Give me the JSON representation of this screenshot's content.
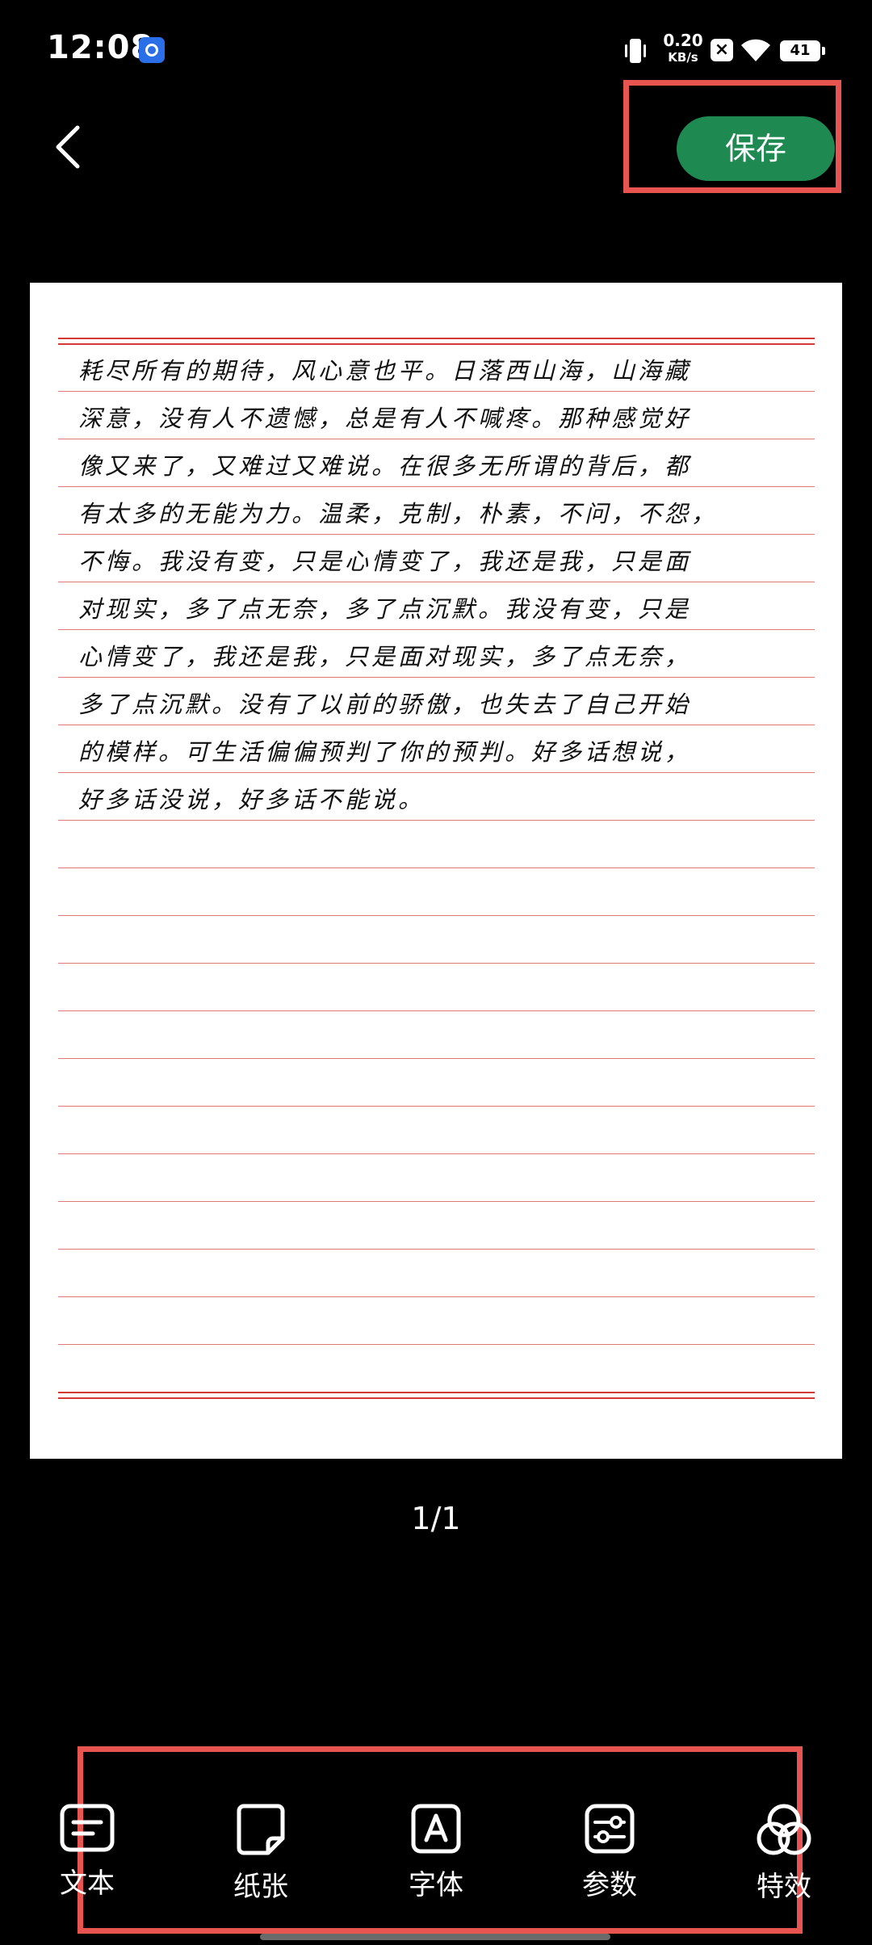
{
  "status_bar": {
    "time": "12:08",
    "net_speed_value": "0.20",
    "net_speed_unit": "KB/s",
    "battery": "41"
  },
  "header": {
    "save_label": "保存"
  },
  "paper": {
    "lines": [
      "耗尽所有的期待，风心意也平。日落西山海，山海藏",
      "深意，没有人不遗憾，总是有人不喊疼。那种感觉好",
      "像又来了，又难过又难说。在很多无所谓的背后，都",
      "有太多的无能为力。温柔，克制，朴素，不问，不怨，",
      "不悔。我没有变，只是心情变了，我还是我，只是面",
      "对现实，多了点无奈，多了点沉默。我没有变，只是",
      "心情变了，我还是我，只是面对现实，多了点无奈，",
      "多了点沉默。没有了以前的骄傲，也失去了自己开始",
      "的模样。可生活偏偏预判了你的预判。好多话想说，",
      "好多话没说，好多话不能说。"
    ]
  },
  "page_indicator": "1/1",
  "toolbar": {
    "items": [
      {
        "label": "文本",
        "icon": "text-icon"
      },
      {
        "label": "纸张",
        "icon": "paper-icon"
      },
      {
        "label": "字体",
        "icon": "font-icon"
      },
      {
        "label": "参数",
        "icon": "params-icon"
      },
      {
        "label": "特效",
        "icon": "effects-icon"
      }
    ]
  },
  "colors": {
    "save_button": "#1e8a52",
    "highlight": "#e85450",
    "rule_line": "#e07a76"
  }
}
